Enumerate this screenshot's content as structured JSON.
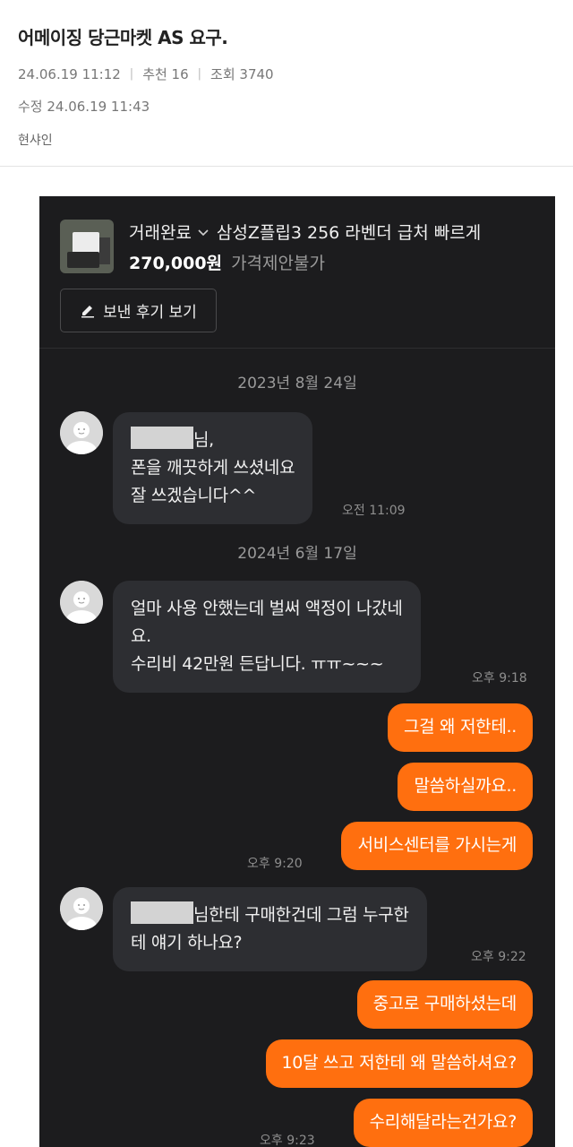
{
  "post": {
    "title": "어메이징 당근마켓 AS 요구.",
    "date": "24.06.19  11:12",
    "recommend": "추천 16",
    "views": "조회 3740",
    "edited": "수정 24.06.19  11:43",
    "author": "현샤인"
  },
  "product": {
    "status": "거래완료",
    "name": "삼성Z플립3 256 라벤더 급처 빠르게",
    "price": "270,000원",
    "nego": "가격제안불가",
    "review_button": "보낸 후기 보기"
  },
  "chat": {
    "date1": "2023년 8월 24일",
    "date2": "2024년 6월 17일",
    "msg1_l1": "님,",
    "msg1_l2": "폰을 깨끗하게 쓰셨네요",
    "msg1_l3": "잘 쓰겠습니다^^",
    "msg1_time": "오전 11:09",
    "msg2_l1": "얼마 사용 안했는데 벌써 액정이 나갔네",
    "msg2_l2": "요.",
    "msg2_l3": "수리비 42만원 든답니다. ㅠㅠ~~~",
    "msg2_time": "오후 9:18",
    "out1": "그걸 왜 저한테..",
    "out2": "말씀하실까요..",
    "out3": "서비스센터를 가시는게",
    "out3_time": "오후 9:20",
    "msg3_l1": "님한테 구매한건데 그럼 누구한",
    "msg3_l2": "테 얘기 하나요?",
    "msg3_time": "오후 9:22",
    "out4": "중고로 구매하셨는데",
    "out5": "10달 쓰고 저한테 왜 말씀하셔요?",
    "out6": "수리해달라는건가요?",
    "out6_time": "오후 9:23"
  },
  "colors": {
    "chat_bg": "#1c1c1e",
    "incoming_bubble": "#2d2e32",
    "outgoing_bubble": "#ff6f0f"
  }
}
